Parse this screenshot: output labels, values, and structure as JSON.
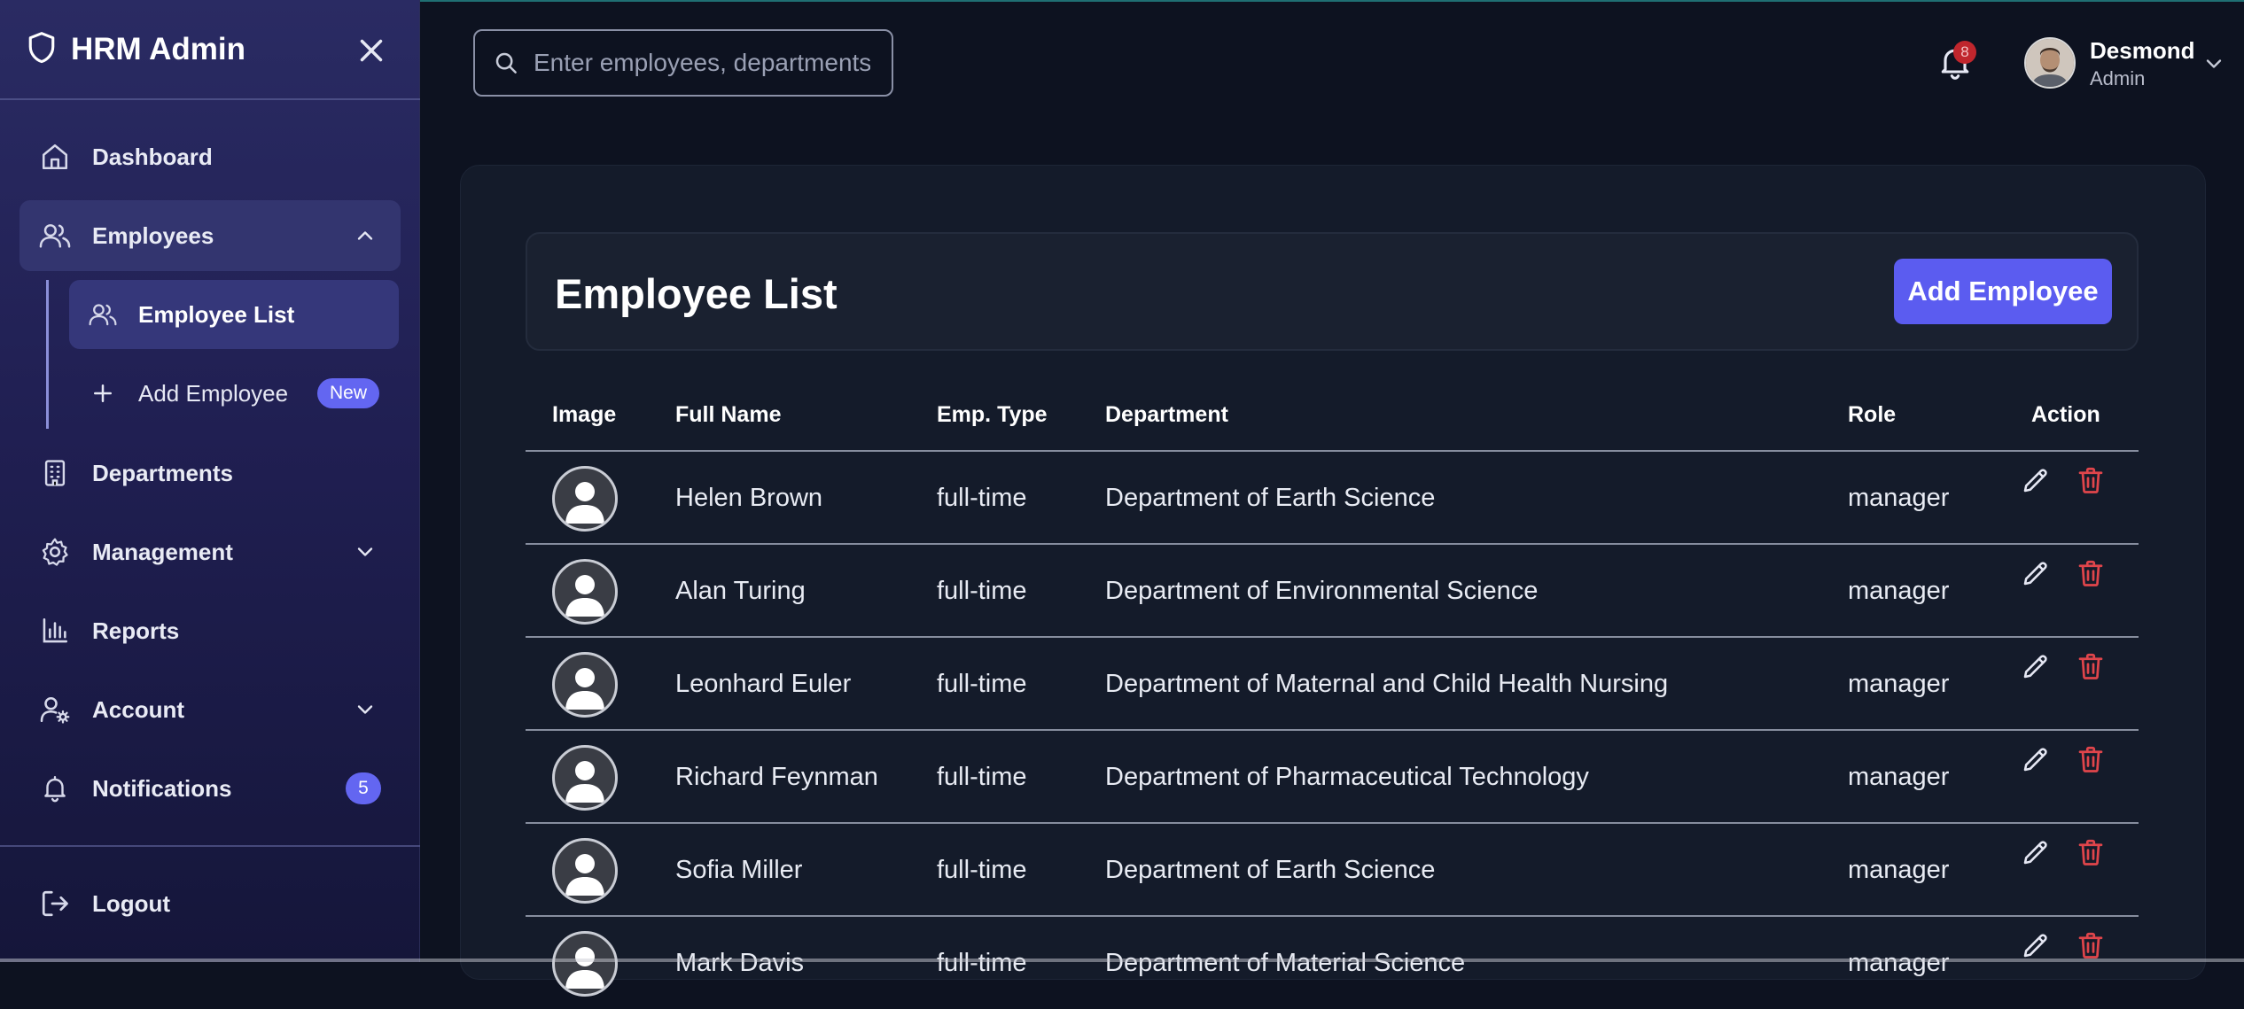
{
  "app": {
    "title": "HRM Admin"
  },
  "sidebar": {
    "items": [
      {
        "label": "Dashboard",
        "icon": "home-icon"
      },
      {
        "label": "Employees",
        "icon": "users-icon",
        "expanded": true
      },
      {
        "label": "Departments",
        "icon": "building-icon"
      },
      {
        "label": "Management",
        "icon": "gear-icon",
        "expanded": false
      },
      {
        "label": "Reports",
        "icon": "bar-chart-icon"
      },
      {
        "label": "Account",
        "icon": "user-cog-icon",
        "expanded": false
      },
      {
        "label": "Notifications",
        "icon": "bell-icon",
        "badge": "5"
      }
    ],
    "subitems": [
      {
        "label": "Employee List",
        "icon": "users-icon",
        "active": true
      },
      {
        "label": "Add Employee",
        "icon": "plus-icon",
        "badge": "New"
      }
    ],
    "logout_label": "Logout"
  },
  "topbar": {
    "search_placeholder": "Enter employees, departments...",
    "notification_count": "8",
    "user": {
      "name": "Desmond",
      "role": "Admin"
    }
  },
  "main": {
    "title": "Employee List",
    "add_button": "Add Employee",
    "columns": [
      "Image",
      "Full Name",
      "Emp. Type",
      "Department",
      "Role",
      "Action"
    ],
    "rows": [
      {
        "name": "Helen Brown",
        "type": "full-time",
        "department": "Department of Earth Science",
        "role": "manager"
      },
      {
        "name": "Alan Turing",
        "type": "full-time",
        "department": "Department of Environmental Science",
        "role": "manager"
      },
      {
        "name": "Leonhard Euler",
        "type": "full-time",
        "department": "Department of Maternal and Child Health Nursing",
        "role": "manager"
      },
      {
        "name": "Richard Feynman",
        "type": "full-time",
        "department": "Department of Pharmaceutical Technology",
        "role": "manager"
      },
      {
        "name": "Sofia Miller",
        "type": "full-time",
        "department": "Department of Earth Science",
        "role": "manager"
      },
      {
        "name": "Mark Davis",
        "type": "full-time",
        "department": "Department of Material Science",
        "role": "manager"
      }
    ]
  },
  "colors": {
    "accent": "#5b5cf0",
    "danger": "#e0454b",
    "sidebar": "#2a2b63",
    "background": "#0d1220"
  }
}
